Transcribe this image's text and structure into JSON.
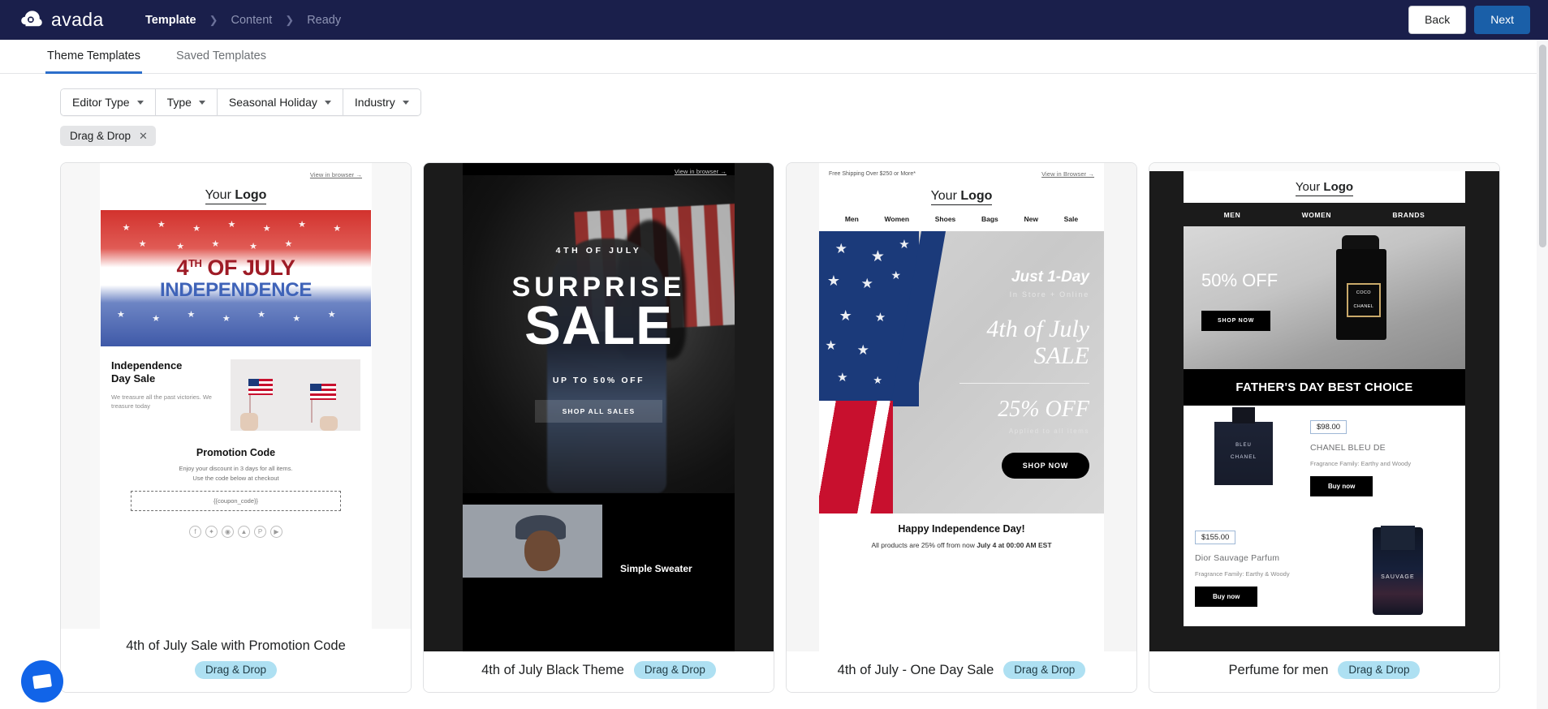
{
  "app": {
    "brand_name": "avada",
    "brand_logo_icon": "avada-cloud-logo-icon"
  },
  "header": {
    "breadcrumbs": [
      {
        "label": "Template",
        "active": true
      },
      {
        "label": "Content",
        "active": false
      },
      {
        "label": "Ready",
        "active": false
      }
    ],
    "back_label": "Back",
    "next_label": "Next"
  },
  "tabs": [
    {
      "label": "Theme Templates",
      "active": true
    },
    {
      "label": "Saved Templates",
      "active": false
    }
  ],
  "filters": [
    {
      "label": "Editor Type",
      "icon": "chevron-down-icon"
    },
    {
      "label": "Type",
      "icon": "chevron-down-icon"
    },
    {
      "label": "Seasonal Holiday",
      "icon": "chevron-down-icon"
    },
    {
      "label": "Industry",
      "icon": "chevron-down-icon"
    }
  ],
  "active_chips": [
    {
      "label": "Drag & Drop",
      "remove_icon": "close-icon"
    }
  ],
  "cards": [
    {
      "title": "4th of July Sale with Promotion Code",
      "tag": "Drag & Drop",
      "layout": "stacked",
      "preview": {
        "view_in_browser": "View in browser →",
        "logo_prefix": "Your ",
        "logo_bold": "Logo",
        "hero_line1": "4",
        "hero_line1_sup": "TH",
        "hero_line1_rest": " OF JULY",
        "hero_line2": "INDEPENDENCE",
        "section_heading": "Independence\nDay Sale",
        "section_body": "We treasure all the past victories. We treasure today",
        "promo_heading": "Promotion Code",
        "promo_body": "Enjoy your discount in 3 days for all items.\nUse the code below at checkout",
        "coupon_code": "{{coupon_code}}",
        "social_icons": [
          "facebook-icon",
          "twitter-icon",
          "instagram-icon",
          "snapchat-icon",
          "pinterest-icon",
          "youtube-icon"
        ]
      }
    },
    {
      "title": "4th of July Black Theme",
      "tag": "Drag & Drop",
      "layout": "inline",
      "preview": {
        "view_in_browser": "View in browser →",
        "kicker": "4TH OF JULY",
        "headline1": "SURPRISE",
        "headline2": "SALE",
        "subline": "UP TO 50% OFF",
        "cta": "SHOP ALL SALES",
        "product_name": "Simple Sweater"
      }
    },
    {
      "title": "4th of July - One Day Sale",
      "tag": "Drag & Drop",
      "layout": "inline",
      "preview": {
        "free_shipping": "Free Shipping Over $250 or More*",
        "view_in_browser": "View in Browser →",
        "logo_prefix": "Your ",
        "logo_bold": "Logo",
        "nav": [
          "Men",
          "Women",
          "Shoes",
          "Bags",
          "New",
          "Sale"
        ],
        "just_one_day": "Just 1-Day",
        "in_store": "In Store + Online",
        "hero_line1": "4th of July",
        "hero_line2": "SALE",
        "discount": "25% OFF",
        "applied": "Applied to all items",
        "cta": "SHOP NOW",
        "footer_heading": "Happy Independence Day!",
        "footer_body_1": "All products are 25% off from now ",
        "footer_body_bold": "July 4 at 00:00 AM EST"
      }
    },
    {
      "title": "Perfume for men",
      "tag": "Drag & Drop",
      "layout": "inline",
      "preview": {
        "logo_prefix": "Your ",
        "logo_bold": "Logo",
        "nav": [
          "MEN",
          "WOMEN",
          "BRANDS"
        ],
        "hero_off": "50% OFF",
        "hero_cta": "SHOP NOW",
        "bottle_label_top": "COCO",
        "bottle_label_bottom": "CHANEL",
        "band": "FATHER'S DAY BEST CHOICE",
        "products": [
          {
            "price": "$98.00",
            "name": "CHANEL BLEU DE",
            "family": "Fragrance Family: Earthy and Woody",
            "cta": "Buy now",
            "bottle_text_top": "BLEU",
            "bottle_text_bottom": "CHANEL"
          },
          {
            "price": "$155.00",
            "name": "Dior Sauvage Parfum",
            "family": "Fragrance Family: Earthy & Woody",
            "cta": "Buy now",
            "bottle_text": "SAUVAGE"
          }
        ]
      }
    }
  ],
  "chat_widget": {
    "icon": "chat-bubble-icon",
    "color": "#1164e8"
  },
  "colors": {
    "topbar_bg": "#1a1f4b",
    "primary": "#1a5fa8",
    "tab_active": "#2c6ecb",
    "tag_bg": "#aee0f2",
    "chip_bg": "#e4e5e7"
  }
}
